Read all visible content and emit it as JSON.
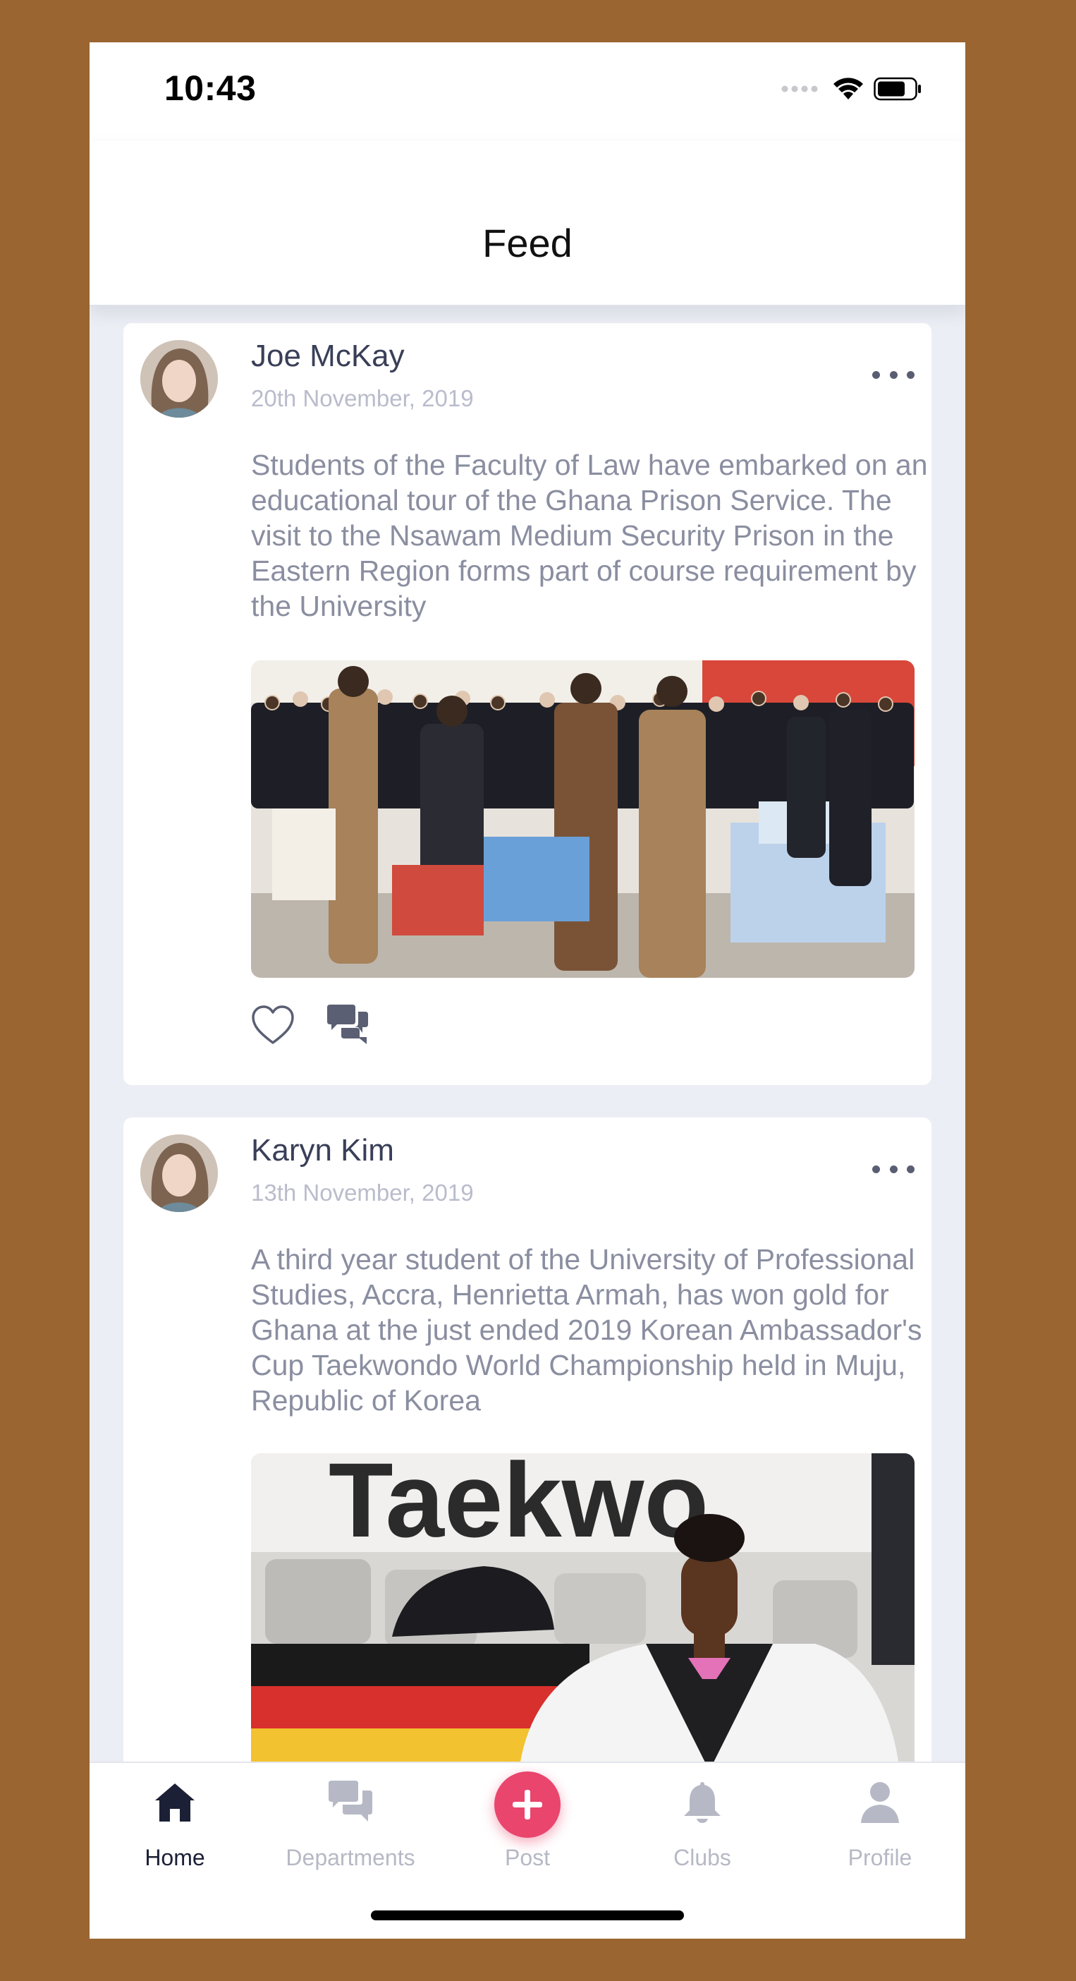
{
  "status_bar": {
    "time": "10:43"
  },
  "header": {
    "title": "Feed"
  },
  "posts": [
    {
      "author": "Joe McKay",
      "date": "20th November, 2019",
      "text": "Students of the Faculty of Law have embarked on an educational tour of the Ghana Prison Service. The visit to the Nsawam Medium Security Prison in the Eastern Region forms part of course requirement by the University",
      "image": "photo-group-officers-donation"
    },
    {
      "author": "Karyn Kim",
      "date": "13th November, 2019",
      "text": "A third year student of the University of Professional Studies, Accra, Henrietta Armah, has won gold for Ghana at the just ended 2019 Korean Ambassador's Cup Taekwondo World Championship held in Muju, Republic of Korea",
      "image": "photo-taekwondo-athlete-flag",
      "image_sign_text": "Taekwo"
    }
  ],
  "tabbar": {
    "items": [
      {
        "label": "Home",
        "icon": "home-icon",
        "active": true
      },
      {
        "label": "Departments",
        "icon": "chat-bubbles-icon",
        "active": false
      },
      {
        "label": "Post",
        "icon": "plus-icon",
        "active": false
      },
      {
        "label": "Clubs",
        "icon": "bell-icon",
        "active": false
      },
      {
        "label": "Profile",
        "icon": "person-icon",
        "active": false
      }
    ]
  },
  "colors": {
    "accent": "#e9456d",
    "background": "#eceef5",
    "author_text": "#3a3f58",
    "body_text": "#8a8ea0",
    "inactive_tab": "#b6b9c5"
  }
}
